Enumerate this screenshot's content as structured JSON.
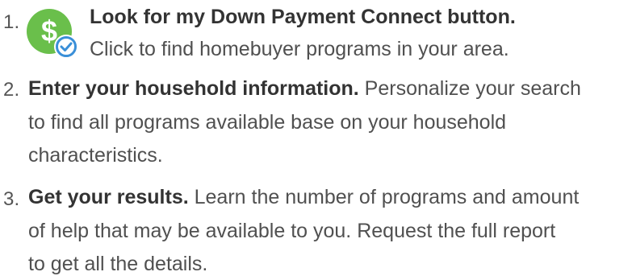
{
  "steps": [
    {
      "number": "1.",
      "title": "Look for my Down Payment Connect button.",
      "description": "Click to find homebuyer programs in your area.",
      "icon": "dollar-check-badge-icon"
    },
    {
      "number": "2.",
      "title": "Enter your household information.",
      "description_line1": " Personalize your search",
      "description_line2": "to find all programs available base on your household",
      "description_line3": "characteristics."
    },
    {
      "number": "3.",
      "title": "Get your results.",
      "description_line1": " Learn the number of programs and amount",
      "description_line2": "of help that may be available to you. Request the full report",
      "description_line3": "to get all the details."
    }
  ],
  "colors": {
    "badge_green": "#6abf4b",
    "check_blue": "#3a8fd8",
    "text": "#505050",
    "bold_text": "#333333"
  }
}
